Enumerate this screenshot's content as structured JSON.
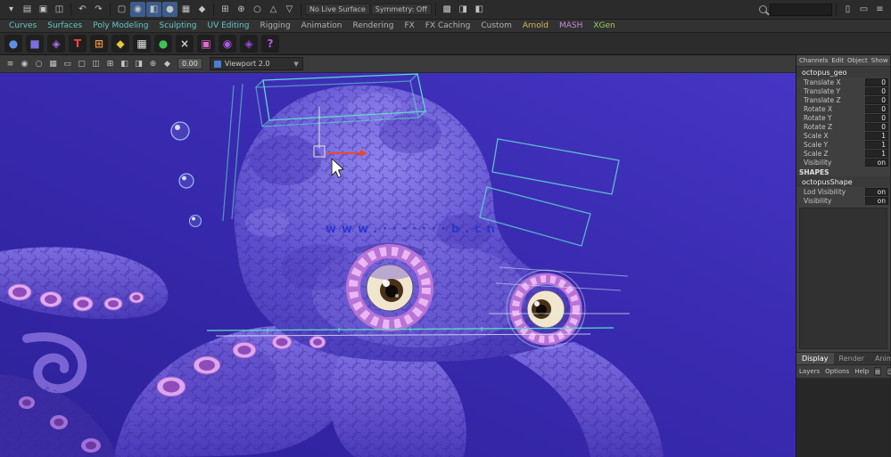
{
  "colors": {
    "viewport_bg": "#3A2BB2",
    "wireframe": "#5FD8CC",
    "watermark": "#2633CC",
    "selection_active": "#3D5C8C"
  },
  "status_line": {
    "file_icons": [
      {
        "name": "menu-set-icon",
        "glyph": "▾"
      },
      {
        "name": "new-scene-icon",
        "glyph": "▤"
      },
      {
        "name": "open-scene-icon",
        "glyph": "▣"
      },
      {
        "name": "save-scene-icon",
        "glyph": "◫"
      }
    ],
    "undo_icons": [
      {
        "name": "undo-icon",
        "glyph": "↶"
      },
      {
        "name": "redo-icon",
        "glyph": "↷"
      }
    ],
    "selection_icons": [
      {
        "name": "select-hierarchy-icon",
        "glyph": "▢"
      },
      {
        "name": "select-object-icon",
        "glyph": "◉",
        "bg": "#3d5c8c"
      },
      {
        "name": "select-component-icon",
        "glyph": "◧",
        "bg": "#3d5c8c"
      },
      {
        "name": "select-mask-points-icon",
        "glyph": "●",
        "bg": "#3d5c8c"
      },
      {
        "name": "select-mask-lines-icon",
        "glyph": "▦"
      },
      {
        "name": "select-mask-faces-icon",
        "glyph": "◆"
      }
    ],
    "snap_icons": [
      {
        "name": "snap-grid-icon",
        "glyph": "⊞"
      },
      {
        "name": "snap-curve-icon",
        "glyph": "⊕"
      },
      {
        "name": "snap-point-icon",
        "glyph": "○"
      },
      {
        "name": "snap-plane-icon",
        "glyph": "△"
      },
      {
        "name": "snap-surface-icon",
        "glyph": "▽"
      }
    ],
    "live_surface_label": "No Live Surface",
    "symmetry_label": "Symmetry: Off",
    "render_icons": [
      {
        "name": "render-icon",
        "glyph": "▩"
      },
      {
        "name": "ipr-render-icon",
        "glyph": "◨"
      },
      {
        "name": "render-settings-icon",
        "glyph": "◧"
      }
    ],
    "search_placeholder": "",
    "right_icons": [
      {
        "name": "sidebar-attr-editor-icon",
        "glyph": "▯"
      },
      {
        "name": "sidebar-tool-settings-icon",
        "glyph": "▭"
      },
      {
        "name": "sidebar-channel-box-icon",
        "glyph": "≡"
      }
    ]
  },
  "shelf_tabs": {
    "items": [
      {
        "label": "Curves",
        "color": "#5fc7c7"
      },
      {
        "label": "Surfaces",
        "color": "#5fc7c7"
      },
      {
        "label": "Poly Modeling",
        "color": "#5fc7c7"
      },
      {
        "label": "Sculpting",
        "color": "#5fc7c7"
      },
      {
        "label": "UV Editing",
        "color": "#5fc7c7"
      },
      {
        "label": "Rigging",
        "color": "#b0b0b0"
      },
      {
        "label": "Animation",
        "color": "#b0b0b0"
      },
      {
        "label": "Rendering",
        "color": "#b0b0b0"
      },
      {
        "label": "FX",
        "color": "#b0b0b0"
      },
      {
        "label": "FX Caching",
        "color": "#b0b0b0"
      },
      {
        "label": "Custom",
        "color": "#b0b0b0"
      },
      {
        "label": "Arnold",
        "color": "#d8b45a"
      },
      {
        "label": "MASH",
        "color": "#c58ae0"
      },
      {
        "label": "XGen",
        "color": "#9ccf5f"
      }
    ]
  },
  "shelf": {
    "icons": [
      {
        "name": "shelf-sphere-icon",
        "glyph": "●",
        "color": "#5e8fe8"
      },
      {
        "name": "shelf-cube-icon",
        "glyph": "■",
        "color": "#7a6fe0"
      },
      {
        "name": "shelf-star-icon",
        "glyph": "◈",
        "color": "#a86fe8"
      },
      {
        "name": "shelf-type-icon",
        "glyph": "T",
        "color": "#e8483a"
      },
      {
        "name": "shelf-construct-icon",
        "glyph": "⊞",
        "color": "#e8923a"
      },
      {
        "name": "shelf-diamond-icon",
        "glyph": "◆",
        "color": "#e8c83a"
      },
      {
        "name": "shelf-checker-icon",
        "glyph": "▦",
        "color": "#e0e0e0"
      },
      {
        "name": "shelf-green-sphere-icon",
        "glyph": "●",
        "color": "#3ec454"
      },
      {
        "name": "shelf-delete-icon",
        "glyph": "×",
        "color": "#cfcfcf"
      },
      {
        "name": "shelf-magenta-grid-icon",
        "glyph": "▣",
        "color": "#e06ad4"
      },
      {
        "name": "shelf-purple-target-icon",
        "glyph": "◉",
        "color": "#b45ae8"
      },
      {
        "name": "shelf-purple-diamond-icon",
        "glyph": "◈",
        "color": "#9a4ae0"
      },
      {
        "name": "shelf-help-icon",
        "glyph": "?",
        "color": "#b45ae8"
      }
    ]
  },
  "viewport_toolbar": {
    "icons": [
      {
        "name": "panel-menu-icon",
        "glyph": "≡"
      },
      {
        "name": "select-camera-icon",
        "glyph": "◉"
      },
      {
        "name": "lock-camera-icon",
        "glyph": "○"
      },
      {
        "name": "grid-icon",
        "glyph": "▦"
      },
      {
        "name": "film-gate-icon",
        "glyph": "▭"
      },
      {
        "name": "resolution-gate-icon",
        "glyph": "▢"
      },
      {
        "name": "gate-mask-icon",
        "glyph": "◫"
      },
      {
        "name": "field-chart-icon",
        "glyph": "⊞"
      },
      {
        "name": "safe-action-icon",
        "glyph": "◧"
      },
      {
        "name": "safe-title-icon",
        "glyph": "◨"
      },
      {
        "name": "lighting-icon",
        "glyph": "⊕"
      },
      {
        "name": "shading-icon",
        "glyph": "◆"
      }
    ],
    "field_value": "0.00",
    "renderer_dropdown": "Viewport 2.0"
  },
  "viewport": {
    "watermark": "www.·······b.cn"
  },
  "channel_box": {
    "menu": [
      "Channels",
      "Edit",
      "Object",
      "Show"
    ],
    "object_name": "octopus_geo",
    "channels": [
      {
        "label": "Translate X",
        "value": "0"
      },
      {
        "label": "Translate Y",
        "value": "0"
      },
      {
        "label": "Translate Z",
        "value": "0"
      },
      {
        "label": "Rotate X",
        "value": "0"
      },
      {
        "label": "Rotate Y",
        "value": "0"
      },
      {
        "label": "Rotate Z",
        "value": "0"
      },
      {
        "label": "Scale X",
        "value": "1"
      },
      {
        "label": "Scale Y",
        "value": "1"
      },
      {
        "label": "Scale Z",
        "value": "1"
      },
      {
        "label": "Visibility",
        "value": "on"
      }
    ],
    "shapes_header": "SHAPES",
    "shape_name": "octopusShape",
    "shape_channels": [
      {
        "label": "Lod Visibility",
        "value": "on"
      },
      {
        "label": "Visibility",
        "value": "on"
      }
    ]
  },
  "layer_editor": {
    "tabs": [
      {
        "label": "Display",
        "bg": "#4a4a4a",
        "color": "#ffffff"
      },
      {
        "label": "Render"
      },
      {
        "label": "Anim"
      }
    ],
    "menu": [
      "Layers",
      "Options",
      "Help"
    ]
  }
}
